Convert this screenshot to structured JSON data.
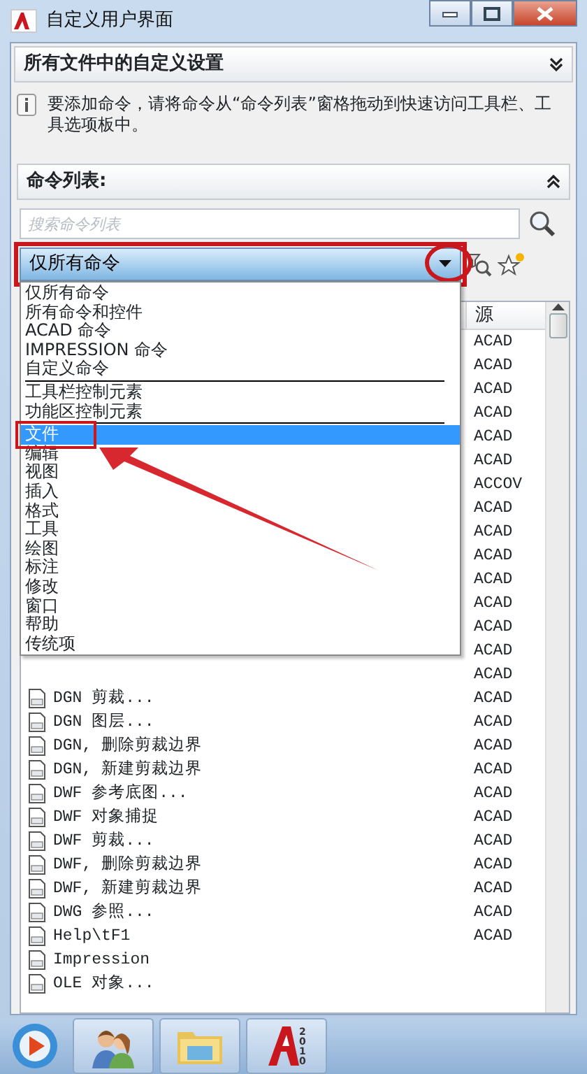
{
  "window": {
    "title": "自定义用户界面"
  },
  "settings_panel": {
    "title": "所有文件中的自定义设置",
    "expanded": false
  },
  "info": {
    "lines": [
      "要添加命令，请将命令从“命令列表”窗格拖动到快速访问工具栏、工",
      "具选项板中。"
    ]
  },
  "command_panel": {
    "title": "命令列表:",
    "expanded": true,
    "search": {
      "placeholder": "搜索命令列表"
    },
    "filter": {
      "value": "仅所有命令",
      "open": true,
      "highlighted": true
    },
    "filter_options": [
      {
        "kind": "option",
        "label": "仅所有命令",
        "selected": false,
        "annotated": false
      },
      {
        "kind": "option",
        "label": "所有命令和控件",
        "selected": false,
        "annotated": false
      },
      {
        "kind": "option",
        "label": "ACAD 命令",
        "selected": false,
        "annotated": false
      },
      {
        "kind": "option",
        "label": "IMPRESSION 命令",
        "selected": false,
        "annotated": false
      },
      {
        "kind": "option",
        "label": "自定义命令",
        "selected": false,
        "annotated": false
      },
      {
        "kind": "separator"
      },
      {
        "kind": "option",
        "label": "工具栏控制元素",
        "selected": false,
        "annotated": false
      },
      {
        "kind": "option",
        "label": "功能区控制元素",
        "selected": false,
        "annotated": false
      },
      {
        "kind": "separator"
      },
      {
        "kind": "option",
        "label": "文件",
        "selected": true,
        "annotated": true
      },
      {
        "kind": "option",
        "label": "编辑",
        "selected": false,
        "annotated": false
      },
      {
        "kind": "option",
        "label": "视图",
        "selected": false,
        "annotated": false
      },
      {
        "kind": "option",
        "label": "插入",
        "selected": false,
        "annotated": false
      },
      {
        "kind": "option",
        "label": "格式",
        "selected": false,
        "annotated": false
      },
      {
        "kind": "option",
        "label": "工具",
        "selected": false,
        "annotated": false
      },
      {
        "kind": "option",
        "label": "绘图",
        "selected": false,
        "annotated": false
      },
      {
        "kind": "option",
        "label": "标注",
        "selected": false,
        "annotated": false
      },
      {
        "kind": "option",
        "label": "修改",
        "selected": false,
        "annotated": false
      },
      {
        "kind": "option",
        "label": "窗口",
        "selected": false,
        "annotated": false
      },
      {
        "kind": "option",
        "label": "帮助",
        "selected": false,
        "annotated": false
      },
      {
        "kind": "option",
        "label": "传统项",
        "selected": false,
        "annotated": false
      }
    ],
    "table": {
      "columns": [
        "源"
      ],
      "rows": [
        {
          "source": "ACAD"
        },
        {
          "source": "ACAD"
        },
        {
          "source": "ACAD"
        },
        {
          "source": "ACAD"
        },
        {
          "source": "ACAD"
        },
        {
          "source": "ACAD"
        },
        {
          "source": "ACCOV"
        },
        {
          "source": "ACAD"
        },
        {
          "source": "ACAD"
        },
        {
          "source": "ACAD"
        },
        {
          "source": "ACAD"
        },
        {
          "source": "ACAD"
        },
        {
          "source": "ACAD"
        },
        {
          "source": "ACAD"
        },
        {
          "source": "ACAD"
        },
        {
          "name": "DGN 剪裁...",
          "source": "ACAD"
        },
        {
          "name": "DGN 图层...",
          "source": "ACAD"
        },
        {
          "name": "DGN, 删除剪裁边界",
          "source": "ACAD"
        },
        {
          "name": "DGN, 新建剪裁边界",
          "source": "ACAD"
        },
        {
          "name": "DWF 参考底图...",
          "source": "ACAD"
        },
        {
          "name": "DWF 对象捕捉",
          "source": "ACAD"
        },
        {
          "name": "DWF 剪裁...",
          "source": "ACAD"
        },
        {
          "name": "DWF, 删除剪裁边界",
          "source": "ACAD"
        },
        {
          "name": "DWF, 新建剪裁边界",
          "source": "ACAD"
        },
        {
          "name": "DWG 参照...",
          "source": "ACAD"
        },
        {
          "name": "Help\\tF1",
          "source": "ACAD"
        },
        {
          "name": "Impression"
        },
        {
          "name": "OLE 对象..."
        }
      ]
    }
  },
  "taskbar": [
    {
      "kind": "start"
    },
    {
      "kind": "contacts"
    },
    {
      "kind": "folder"
    },
    {
      "kind": "autocad",
      "badge": "2010"
    }
  ]
}
